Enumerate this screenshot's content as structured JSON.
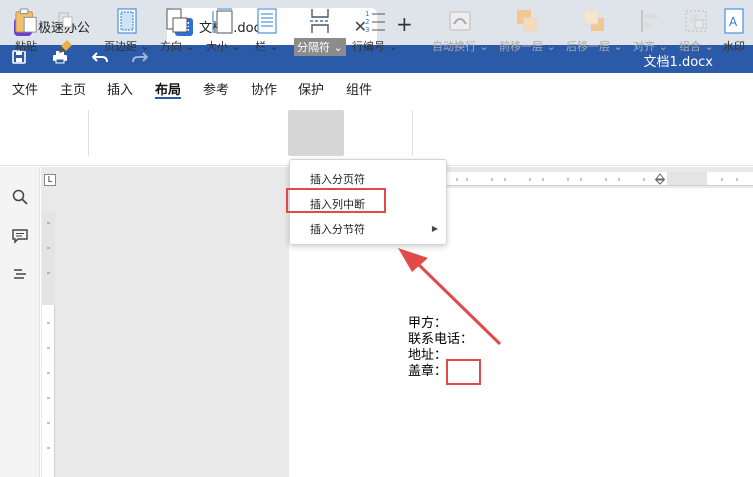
{
  "tabs": {
    "app": {
      "label": "极速办公"
    },
    "doc": {
      "label": "文档1.docx*",
      "close": "✕"
    },
    "add": "+"
  },
  "titlebar": {
    "title": "文档1.docx"
  },
  "menu": [
    "文件",
    "主页",
    "插入",
    "布局",
    "参考",
    "协作",
    "保护",
    "组件"
  ],
  "ribbon": {
    "paste": "粘贴",
    "margins": "页边距",
    "orientation": "方向",
    "size": "大小",
    "columns": "栏",
    "breaks": "分隔符",
    "line_numbers": "行编号",
    "wrap": "自动换行",
    "bring_forward": "前移一层",
    "send_backward": "后移一层",
    "align": "对齐",
    "group": "组合",
    "watermark": "水印"
  },
  "dropdown": {
    "items": [
      "插入分页符",
      "插入列中断",
      "插入分节符"
    ]
  },
  "document": {
    "lines": [
      "甲方：",
      "联系电话：",
      "地址：",
      "盖章："
    ]
  },
  "colors": {
    "accent": "#2b5aa8",
    "annotation": "#e24a4a"
  }
}
